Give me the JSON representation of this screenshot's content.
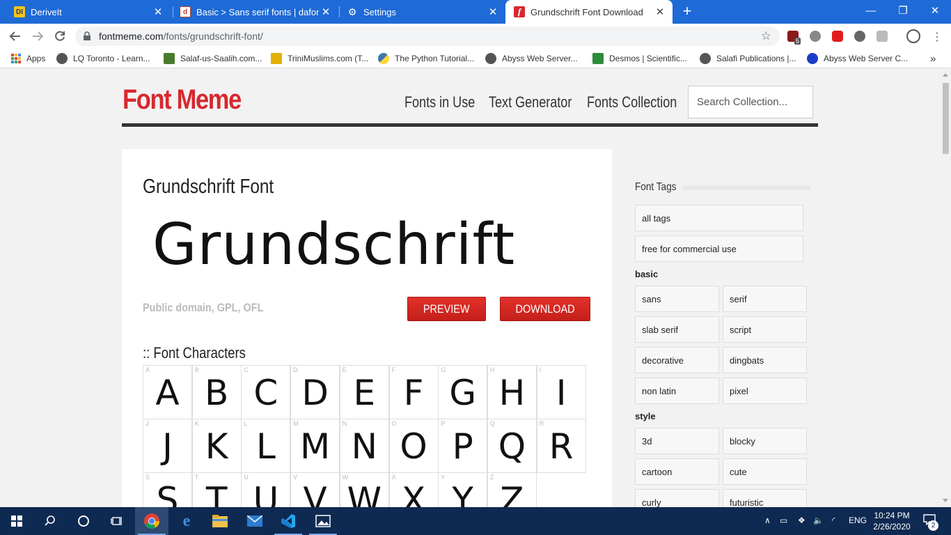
{
  "browser": {
    "tabs": [
      {
        "title": "DeriveIt",
        "icon": "deriveit-favicon",
        "color": "#f5c518",
        "letter": "DI"
      },
      {
        "title": "Basic > Sans serif fonts | dafont.c",
        "icon": "dafont-favicon",
        "color": "#c0392b",
        "letter": "d"
      },
      {
        "title": "Settings",
        "icon": "gear-icon",
        "color": "#1e6ad6",
        "letter": "⚙"
      },
      {
        "title": "Grundschrift Font Download",
        "icon": "fontmeme-favicon",
        "color": "#d7282f",
        "letter": "f"
      }
    ],
    "url_domain": "fontmeme.com",
    "url_path": "/fonts/grundschrift-font/",
    "bookmarks": [
      {
        "label": "Apps",
        "color": "#888"
      },
      {
        "label": "LQ Toronto - Learn...",
        "color": "#555"
      },
      {
        "label": "Salaf-us-Saalih.com...",
        "color": "#4a7a2a"
      },
      {
        "label": "TriniMuslims.com (T...",
        "color": "#e2b007"
      },
      {
        "label": "The Python Tutorial...",
        "color": "#3c78aa"
      },
      {
        "label": "Abyss Web Server...",
        "color": "#555"
      },
      {
        "label": "Desmos | Scientific...",
        "color": "#2e8b3a"
      },
      {
        "label": "Salafi Publications |...",
        "color": "#555"
      },
      {
        "label": "Abyss Web Server C...",
        "color": "#1a3cc7"
      }
    ],
    "extension_badge": "5",
    "more_bookmarks": "»"
  },
  "site": {
    "logo": "Font Meme",
    "nav": [
      "Fonts in Use",
      "Text Generator",
      "Fonts Collection"
    ],
    "search_placeholder": "Search Collection..."
  },
  "font": {
    "title": "Grundschrift Font",
    "sample": "Grundschrift",
    "license": "Public domain, GPL, OFL",
    "preview_label": "PREVIEW",
    "download_label": "DOWNLOAD",
    "characters_heading": ":: Font Characters",
    "characters": [
      "A",
      "B",
      "C",
      "D",
      "E",
      "F",
      "G",
      "H",
      "I",
      "J",
      "K",
      "L",
      "M",
      "N",
      "O",
      "P",
      "Q",
      "R",
      "S",
      "T",
      "U",
      "V",
      "W",
      "X",
      "Y",
      "Z"
    ]
  },
  "sidebar": {
    "heading": "Font Tags",
    "top_tags": [
      "all tags",
      "free for commercial use"
    ],
    "groups": [
      {
        "name": "basic",
        "tags": [
          "sans",
          "serif",
          "slab serif",
          "script",
          "decorative",
          "dingbats",
          "non latin",
          "pixel"
        ]
      },
      {
        "name": "style",
        "tags": [
          "3d",
          "blocky",
          "cartoon",
          "cute",
          "curly",
          "futuristic"
        ]
      }
    ]
  },
  "taskbar": {
    "lang": "ENG",
    "time": "10:24 PM",
    "date": "2/26/2020",
    "notifications": "2"
  }
}
